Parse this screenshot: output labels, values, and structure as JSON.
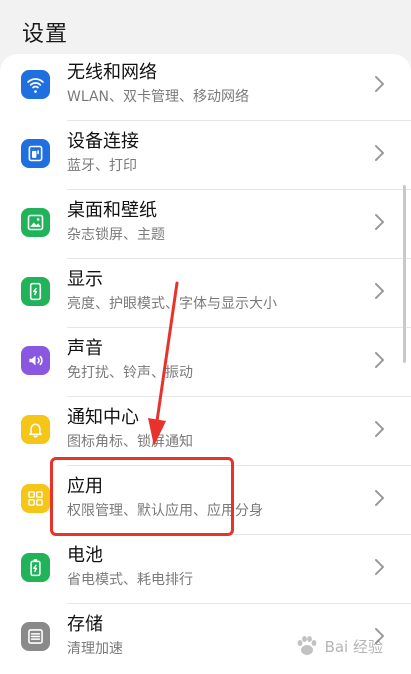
{
  "header": {
    "title": "设置"
  },
  "items": [
    {
      "title": "无线和网络",
      "subtitle": "WLAN、双卡管理、移动网络",
      "icon": "wifi-icon",
      "color": "#1f6fe0"
    },
    {
      "title": "设备连接",
      "subtitle": "蓝牙、打印",
      "icon": "device-connect-icon",
      "color": "#1f6fe0"
    },
    {
      "title": "桌面和壁纸",
      "subtitle": "杂志锁屏、主题",
      "icon": "wallpaper-icon",
      "color": "#20b35a"
    },
    {
      "title": "显示",
      "subtitle": "亮度、护眼模式、字体与显示大小",
      "icon": "display-icon",
      "color": "#20b35a"
    },
    {
      "title": "声音",
      "subtitle": "免打扰、铃声、振动",
      "icon": "sound-icon",
      "color": "#8957e0"
    },
    {
      "title": "通知中心",
      "subtitle": "图标角标、锁屏通知",
      "icon": "bell-icon",
      "color": "#f5c518"
    },
    {
      "title": "应用",
      "subtitle": "权限管理、默认应用、应用分身",
      "icon": "apps-grid-icon",
      "color": "#f5c518"
    },
    {
      "title": "电池",
      "subtitle": "省电模式、耗电排行",
      "icon": "battery-icon",
      "color": "#20b35a"
    },
    {
      "title": "存储",
      "subtitle": "清理加速",
      "icon": "storage-icon",
      "color": "#8a8a8a"
    }
  ],
  "annotation": {
    "color": "#e8332b"
  },
  "watermark": {
    "text": "Bai 经验"
  }
}
